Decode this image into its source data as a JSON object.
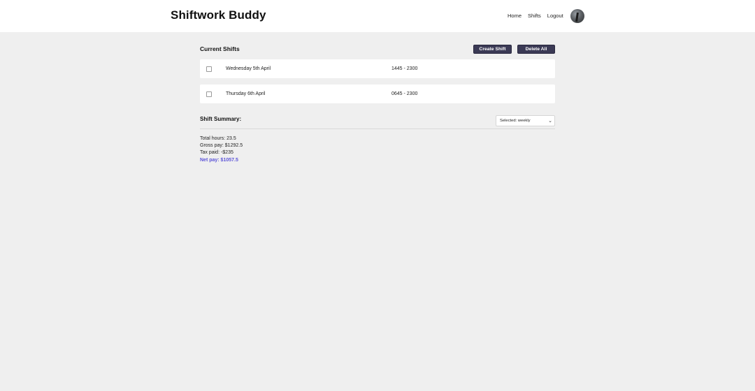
{
  "header": {
    "brand": "Shiftwork Buddy",
    "nav": [
      "Home",
      "Shifts",
      "Logout"
    ]
  },
  "shifts_section": {
    "title": "Current Shifts",
    "create_label": "Create Shift",
    "delete_label": "Delete All",
    "rows": [
      {
        "date": "Wednesday 5th April",
        "time": "1445 - 2300"
      },
      {
        "date": "Thursday 6th April",
        "time": "0645 - 2300"
      }
    ]
  },
  "summary": {
    "title": "Shift Summary:",
    "select_value": "Selected: weekly",
    "total_hours": "Total hours: 23.5",
    "gross_pay": "Gross pay: $1292.5",
    "tax_paid": "Tax paid: -$235",
    "net_pay": "Net pay: $1057.5"
  },
  "colors": {
    "button_bg": "#3b3a55",
    "net_pay": "#5d55d8",
    "page_bg": "#efefef"
  }
}
